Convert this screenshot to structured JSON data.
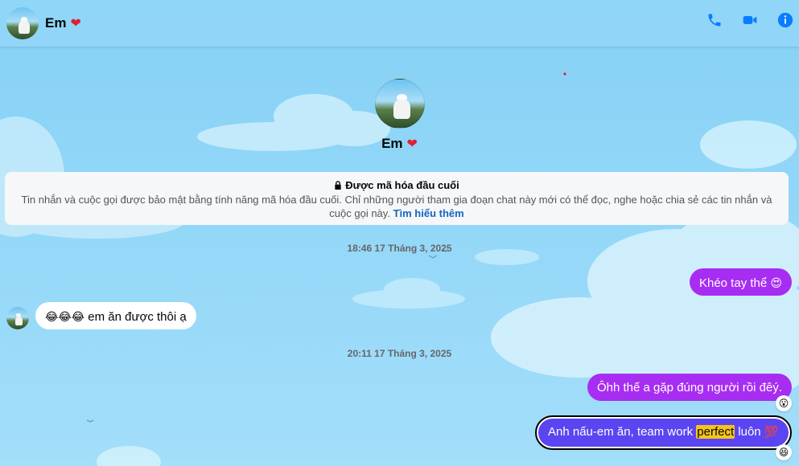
{
  "header": {
    "contact_name": "Em",
    "heart": "❤",
    "actions": [
      "phone-icon",
      "video-icon",
      "info-icon"
    ]
  },
  "profile": {
    "name": "Em",
    "heart": "❤"
  },
  "encryption_notice": {
    "title": "Được mã hóa đầu cuối",
    "body": "Tin nhắn và cuộc gọi được bảo mật bằng tính năng mã hóa đầu cuối. Chỉ những người tham gia đoạn chat này mới có thể đọc, nghe hoặc chia sẻ các tin nhắn và cuộc gọi này.",
    "link": "Tìm hiểu thêm"
  },
  "messages": {
    "ts1": "18:46 17 Tháng 3, 2025",
    "msg1": {
      "text": "Khéo tay thể",
      "emoji": "😍"
    },
    "msg2": {
      "emoji": "😂😂😂",
      "text": "em ăn được thôi ạ"
    },
    "ts2": "20:11 17 Tháng 3, 2025",
    "msg3": {
      "text": "Ôhh thế a gặp đúng người rồi đêý.",
      "reaction": "😮"
    },
    "msg4": {
      "prefix": "Anh nấu-em ăn, team work ",
      "highlight": "perfect",
      "suffix": " luôn",
      "emoji": "💯",
      "reaction": "😆"
    }
  },
  "colors": {
    "background": "#8fd6f7",
    "outgoing_bubble": "#a82df2",
    "selected_bubble": "#5b45f2",
    "icon_blue": "#0a7cff"
  }
}
